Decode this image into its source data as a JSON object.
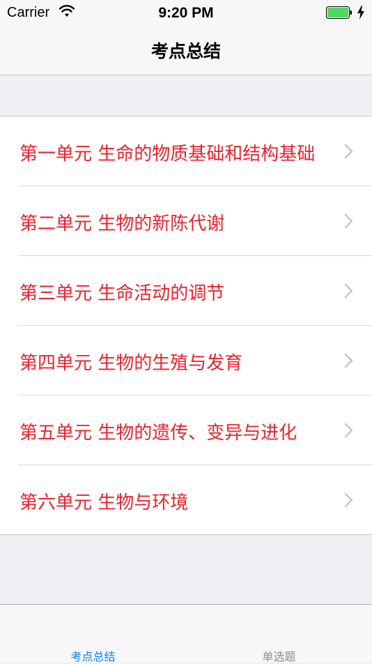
{
  "status_bar": {
    "carrier": "Carrier",
    "time": "9:20 PM",
    "wifi_icon": "wifi-icon",
    "battery_icon": "battery-icon",
    "charging_icon": "charging-bolt-icon",
    "battery_color": "#4cd964"
  },
  "nav": {
    "title": "考点总结"
  },
  "list": {
    "text_color": "#e8232e",
    "items": [
      {
        "label": "第一单元  生命的物质基础和结构基础"
      },
      {
        "label": "第二单元  生物的新陈代谢"
      },
      {
        "label": "第三单元  生命活动的调节"
      },
      {
        "label": "第四单元  生物的生殖与发育"
      },
      {
        "label": "第五单元  生物的遗传、变异与进化"
      },
      {
        "label": "第六单元  生物与环境"
      }
    ]
  },
  "tab_bar": {
    "active_color": "#0b7cff",
    "inactive_color": "#8e8e93",
    "tabs": [
      {
        "label": "考点总结",
        "active": true
      },
      {
        "label": "单选题",
        "active": false
      }
    ]
  }
}
